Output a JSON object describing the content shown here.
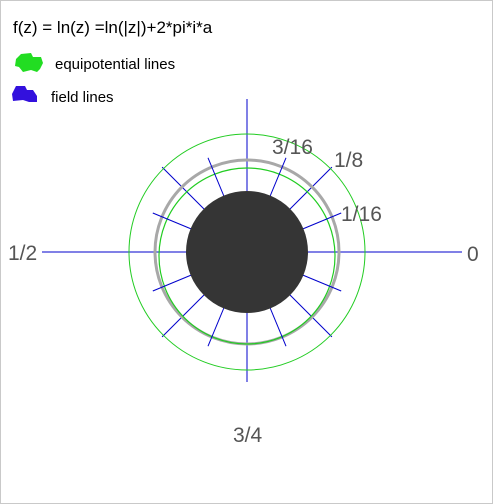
{
  "formula": "f(z) = ln(z) =ln(|z|)+2*pi*i*a",
  "legend": {
    "equipotential": {
      "label": "equipotential lines",
      "color": "#22dd22"
    },
    "field": {
      "label": "field lines",
      "color": "#3311dd"
    }
  },
  "labels": {
    "zero": "0",
    "one_sixteenth": "1/16",
    "one_eighth": "1/8",
    "three_sixteenths": "3/16",
    "one_half": "1/2",
    "three_quarters": "3/4"
  },
  "colors": {
    "equipotential_line": "#22cc22",
    "field_line": "#0000cc",
    "disk": "#353535",
    "grey_ring": "#a8a8a8",
    "label": "#555555"
  }
}
